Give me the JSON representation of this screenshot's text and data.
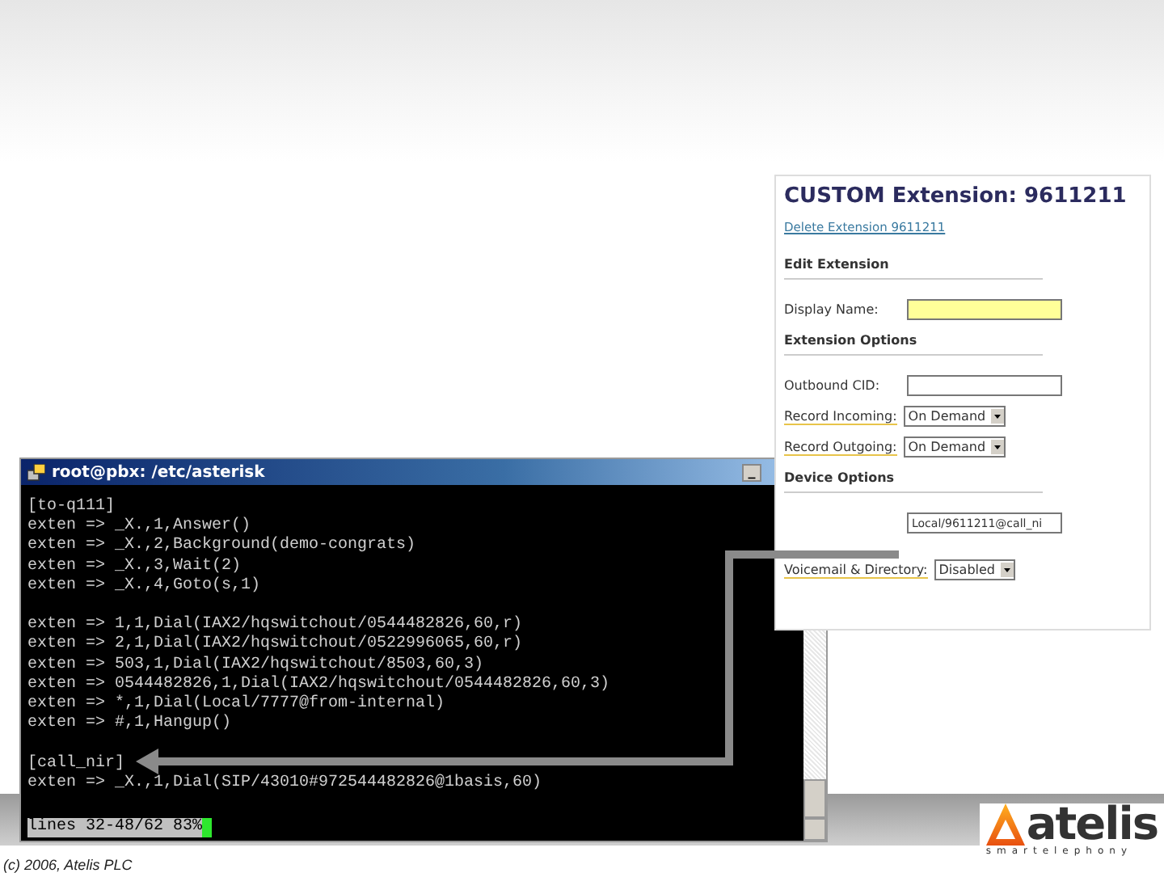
{
  "terminal": {
    "title": "root@pbx: /etc/asterisk",
    "minimize": "_",
    "blocks": [
      [
        "[to-q111]",
        "exten => _X.,1,Answer()",
        "exten => _X.,2,Background(demo-congrats)",
        "exten => _X.,3,Wait(2)",
        "exten => _X.,4,Goto(s,1)"
      ],
      [
        "exten => 1,1,Dial(IAX2/hqswitchout/0544482826,60,r)",
        "exten => 2,1,Dial(IAX2/hqswitchout/0522996065,60,r)",
        "exten => 503,1,Dial(IAX2/hqswitchout/8503,60,3)",
        "exten => 0544482826,1,Dial(IAX2/hqswitchout/0544482826,60,3)",
        "exten => *,1,Dial(Local/7777@from-internal)",
        "exten => #,1,Hangup()"
      ],
      [
        "[call_nir]",
        "exten => _X.,1,Dial(SIP/43010#972544482826@1basis,60)"
      ]
    ],
    "status": "lines 32-48/62 83%"
  },
  "extension_panel": {
    "title": "CUSTOM Extension: 9611211",
    "delete_link": "Delete Extension 9611211",
    "rows": [
      {
        "kind": "section",
        "label": "Edit Extension"
      },
      {
        "kind": "text",
        "label": "Display Name:",
        "value": "",
        "highlighted": true
      },
      {
        "kind": "section",
        "label": "Extension Options"
      },
      {
        "kind": "text",
        "label": "Outbound CID:",
        "value": "",
        "highlighted": false
      },
      {
        "kind": "select",
        "label": "Record Incoming:",
        "value": "On Demand"
      },
      {
        "kind": "select",
        "label": "Record Outgoing:",
        "value": "On Demand"
      },
      {
        "kind": "section",
        "label": "Device Options"
      },
      {
        "kind": "text",
        "label": "",
        "value": "Local/9611211@call_ni",
        "highlighted": false
      },
      {
        "kind": "select",
        "label": "Voicemail & Directory:",
        "value": "Disabled"
      }
    ]
  },
  "footer": {
    "copyright": "(c) 2006, Atelis PLC",
    "logo_name": "atelis",
    "logo_tagline": "smartelephony"
  }
}
